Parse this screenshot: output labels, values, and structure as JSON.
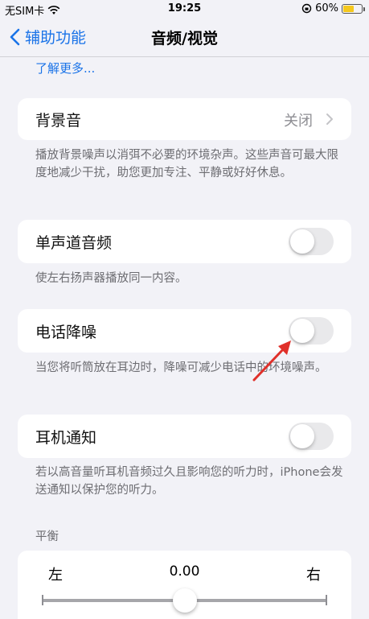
{
  "status_bar": {
    "carrier": "无SIM卡",
    "time": "19:25",
    "battery_percent": "60%",
    "battery_level": 0.6
  },
  "nav": {
    "back_label": "辅助功能",
    "title": "音频/视觉"
  },
  "learn_more": "了解更多...",
  "background_sounds": {
    "label": "背景音",
    "value": "关闭",
    "footer": "播放背景噪声以消弭不必要的环境杂声。这些声音可最大限度地减少干扰，助您更加专注、平静或好好休息。"
  },
  "mono_audio": {
    "label": "单声道音频",
    "on": false,
    "footer": "使左右扬声器播放同一内容。"
  },
  "phone_noise": {
    "label": "电话降噪",
    "on": false,
    "footer": "当您将听筒放在耳边时，降噪可减少电话中的环境噪声。"
  },
  "headphone_notify": {
    "label": "耳机通知",
    "on": false,
    "footer": "若以高音量听耳机音频过久且影响您的听力时，iPhone会发送通知以保护您的听力。"
  },
  "balance": {
    "header": "平衡",
    "left": "左",
    "right": "右",
    "value": "0.00",
    "position": 0.5
  },
  "colors": {
    "accent": "#1a73e8",
    "background": "#f2f2f7",
    "arrow": "#e0302a"
  }
}
